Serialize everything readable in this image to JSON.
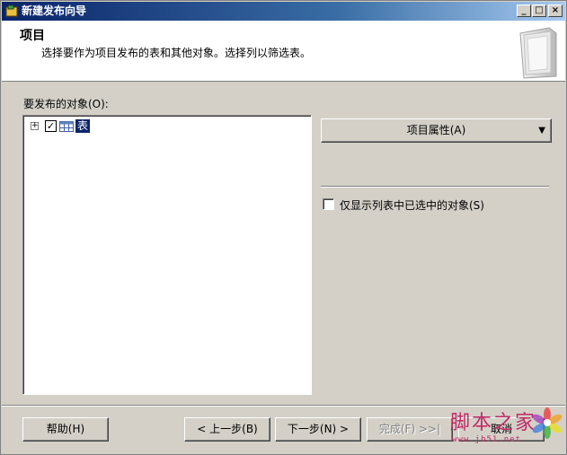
{
  "window": {
    "title": "新建发布向导",
    "controls": {
      "minimize": "_",
      "maximize": "□",
      "close": "×"
    }
  },
  "header": {
    "title": "项目",
    "subtitle": "选择要作为项目发布的表和其他对象。选择列以筛选表。",
    "art_icon": "folder-illustration-icon"
  },
  "objects": {
    "label": "要发布的对象(O):",
    "tree": [
      {
        "label": "表",
        "expander": "+",
        "checked": true,
        "selected": true,
        "icon": "table-icon"
      }
    ]
  },
  "properties_button": {
    "label": "项目属性(A)",
    "arrow": "▼"
  },
  "only_selected": {
    "label": "仅显示列表中已选中的对象(S)",
    "checked": false
  },
  "footer": {
    "help": "帮助(H)",
    "back": "< 上一步(B)",
    "next": "下一步(N) >",
    "finish": "完成(F) >>|",
    "cancel": "取消"
  },
  "watermark": {
    "text": "脚本之家",
    "url": "www.jb51.net"
  },
  "colors": {
    "titlebar_start": "#0a246a",
    "titlebar_end": "#a6caf0",
    "face": "#d4d0c8",
    "selection": "#0a246a",
    "watermark": "#c02a66"
  }
}
